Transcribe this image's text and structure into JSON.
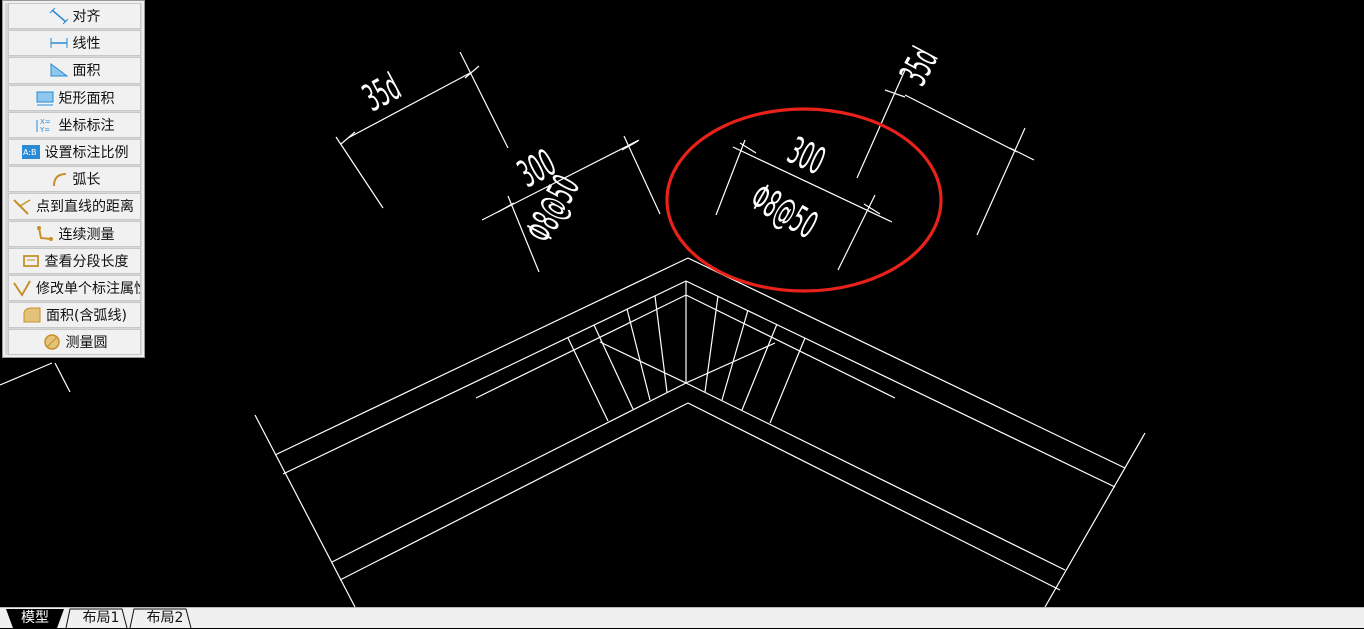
{
  "menu": {
    "items": [
      {
        "label": "对齐",
        "icon": "align-dimension-icon"
      },
      {
        "label": "线性",
        "icon": "linear-dimension-icon"
      },
      {
        "label": "面积",
        "icon": "area-icon"
      },
      {
        "label": "矩形面积",
        "icon": "rectangle-area-icon"
      },
      {
        "label": "坐标标注",
        "icon": "coordinate-dimension-icon"
      },
      {
        "label": "设置标注比例",
        "icon": "dimension-scale-icon"
      },
      {
        "label": "弧长",
        "icon": "arc-length-icon"
      },
      {
        "label": "点到直线的距离",
        "icon": "point-to-line-distance-icon"
      },
      {
        "label": "连续测量",
        "icon": "continuous-measure-icon"
      },
      {
        "label": "查看分段长度",
        "icon": "segment-length-icon"
      },
      {
        "label": "修改单个标注属性",
        "icon": "edit-dimension-icon"
      },
      {
        "label": "面积(含弧线)",
        "icon": "area-with-arc-icon"
      },
      {
        "label": "测量圆",
        "icon": "measure-circle-icon"
      }
    ]
  },
  "drawing": {
    "dim_left_35d": "35d",
    "dim_left_300": "300",
    "dim_left_rebar": "Φ8@50",
    "dim_right_35d": "35d",
    "dim_right_300": "300",
    "dim_right_rebar": "Φ8@50",
    "highlight_color": "#e8221b",
    "line_color": "#ffffff"
  },
  "tabs": [
    {
      "label": "模型",
      "active": true
    },
    {
      "label": "布局1",
      "active": false
    },
    {
      "label": "布局2",
      "active": false
    }
  ]
}
